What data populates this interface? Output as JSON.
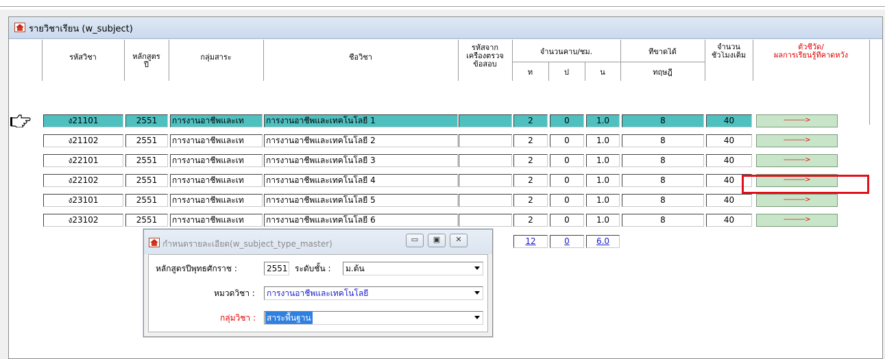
{
  "main_window": {
    "title": "รายวิชาเรียน (w_subject)",
    "header": {
      "col_code": "รหัสวิชา",
      "col_curriculum_line1": "หลักสูตร",
      "col_curriculum_line2": "ปี",
      "col_group": "กลุ่มสาระ",
      "col_name": "ชื่อวิชา",
      "col_exam_line1": "รหัสจาก",
      "col_exam_line2": "เครื่องตรวจ",
      "col_exam_line3": "ข้อสอบ",
      "col_periods": "จำนวนคาบ/ชม.",
      "col_t": "ท",
      "col_p": "ป",
      "col_n": "น",
      "col_result": "ที่ขาดได้",
      "col_theory": "ทฤษฎี",
      "col_hours_line1": "จำนวน",
      "col_hours_line2": "ชั่วโมงเต็ม",
      "col_indicator_line1": "ตัวชี้วัด/",
      "col_indicator_line2": "ผลการเรียนรู้ที่คาดหวัง"
    },
    "rows": [
      {
        "code": "ง21101",
        "year": "2551",
        "group": "การงานอาชีพและเท",
        "name": "การงานอาชีพและเทคโนโลยี 1",
        "exam": "",
        "t": "2",
        "p": "0",
        "n": "1.0",
        "theory": "8",
        "hours": "40",
        "link": "---------->"
      },
      {
        "code": "ง21102",
        "year": "2551",
        "group": "การงานอาชีพและเท",
        "name": "การงานอาชีพและเทคโนโลยี 2",
        "exam": "",
        "t": "2",
        "p": "0",
        "n": "1.0",
        "theory": "8",
        "hours": "40",
        "link": "---------->"
      },
      {
        "code": "ง22101",
        "year": "2551",
        "group": "การงานอาชีพและเท",
        "name": "การงานอาชีพและเทคโนโลยี 3",
        "exam": "",
        "t": "2",
        "p": "0",
        "n": "1.0",
        "theory": "8",
        "hours": "40",
        "link": "---------->"
      },
      {
        "code": "ง22102",
        "year": "2551",
        "group": "การงานอาชีพและเท",
        "name": "การงานอาชีพและเทคโนโลยี 4",
        "exam": "",
        "t": "2",
        "p": "0",
        "n": "1.0",
        "theory": "8",
        "hours": "40",
        "link": "---------->"
      },
      {
        "code": "ง23101",
        "year": "2551",
        "group": "การงานอาชีพและเท",
        "name": "การงานอาชีพและเทคโนโลยี 5",
        "exam": "",
        "t": "2",
        "p": "0",
        "n": "1.0",
        "theory": "8",
        "hours": "40",
        "link": "---------->"
      },
      {
        "code": "ง23102",
        "year": "2551",
        "group": "การงานอาชีพและเท",
        "name": "การงานอาชีพและเทคโนโลยี 6",
        "exam": "",
        "t": "2",
        "p": "0",
        "n": "1.0",
        "theory": "8",
        "hours": "40",
        "link": "---------->"
      }
    ],
    "totals": {
      "t": "12",
      "p": "0",
      "n": "6.0"
    },
    "selected_row": 0,
    "highlighted_row": 4
  },
  "dialog": {
    "title": "กำหนดรายละเอียด(w_subject_type_master)",
    "year_label": "หลักสูตรปีพุทธศักราช :",
    "year_value": "2551",
    "level_label": "ระดับชั้น :",
    "level_value": "ม.ต้น",
    "category_label": "หมวดวิชา :",
    "category_value": "การงานอาชีพและเทคโนโลยี",
    "group_label": "กลุ่มวิชา :",
    "group_value": "สาระพื้นฐาน",
    "btn_minimize": "▭",
    "btn_maximize": "▣",
    "btn_close": "✕"
  },
  "colors": {
    "selected_row": "#4ec0c0",
    "link_button": "#c9e5c9",
    "highlight": "#e0101a",
    "required_label": "#e00000"
  }
}
